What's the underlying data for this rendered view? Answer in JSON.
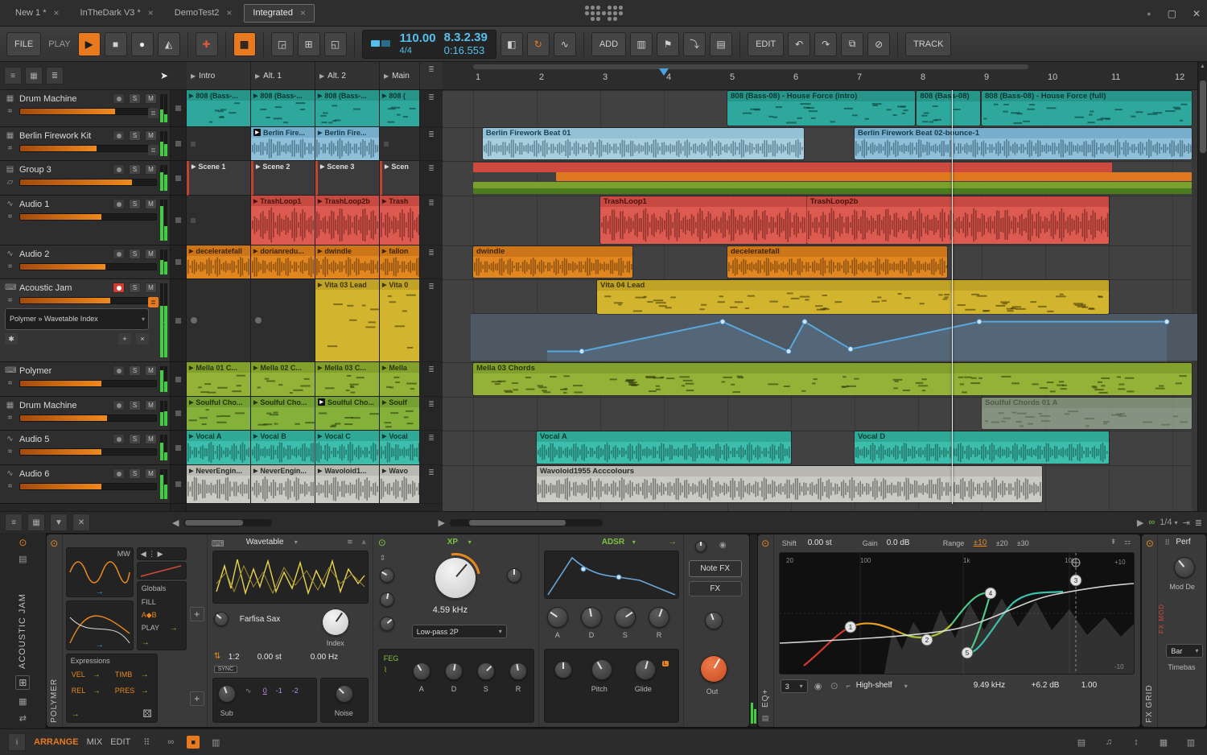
{
  "icons": {
    "close": "×",
    "restore": "▢",
    "conn_dot": "●",
    "play": "▶",
    "stop": "■",
    "record": "●",
    "metronome": "◭",
    "auto_write": "✚",
    "launcher_grid": "▦",
    "clip_rec": "◲",
    "plus": "⊞",
    "capture": "◱",
    "punch_in": "◧",
    "loop": "↻",
    "swing": "∿",
    "bars": "▥",
    "flag": "⚑",
    "arrow_down": "⤵",
    "panel": "▤",
    "undo": "↶",
    "redo": "↷",
    "copy": "⧉",
    "delete": "⊘",
    "pointer": "➤",
    "list": "≡",
    "grid": "▦",
    "menu": "≣",
    "left": "◀",
    "right": "▶",
    "up": "▲",
    "down": "▼",
    "link": "∞",
    "snap": "⇥",
    "info": "i",
    "dice": "⚄",
    "pin": "⊼",
    "star": "✱",
    "keyboard": "⌨",
    "power": "⊙",
    "folder": "▤",
    "swap": "⇄",
    "speaker": "◉",
    "x": "✕",
    "caret": "▾"
  },
  "window": {
    "tabs": [
      {
        "label": "New 1 *",
        "active": false
      },
      {
        "label": "InTheDark V3 *",
        "active": false
      },
      {
        "label": "DemoTest2",
        "active": false
      },
      {
        "label": "Integrated",
        "active": true
      }
    ]
  },
  "toolbar": {
    "file": "FILE",
    "play_label": "PLAY",
    "add": "ADD",
    "edit": "EDIT",
    "track": "TRACK",
    "tempo": "110.00",
    "timesig": "4/4",
    "position": "8.3.2.39",
    "time": "0:16.553"
  },
  "tracks": [
    {
      "name": "Drum Machine",
      "type": "drum",
      "meter": 0.7,
      "menu": "gray"
    },
    {
      "name": "Berlin Firework Kit",
      "type": "drum",
      "meter": 0.56,
      "menu": "gray"
    },
    {
      "name": "Group 3",
      "type": "group",
      "meter": 0.82
    },
    {
      "name": "Audio 1",
      "type": "audio",
      "meter": 0.6
    },
    {
      "name": "Audio 2",
      "type": "audio",
      "meter": 0.63
    },
    {
      "name": "Acoustic Jam",
      "type": "inst",
      "armed": true,
      "meter": 0.66,
      "menu": "orange",
      "device": "Polymer » Wavetable Index"
    },
    {
      "name": "Polymer",
      "type": "inst",
      "meter": 0.6
    },
    {
      "name": "Drum Machine",
      "type": "drum",
      "meter": 0.64
    },
    {
      "name": "Audio 5",
      "type": "audio",
      "meter": 0.6
    },
    {
      "name": "Audio 6",
      "type": "audio",
      "meter": 0.6
    }
  ],
  "scenes": [
    "Intro",
    "Alt. 1",
    "Alt. 2",
    "Main"
  ],
  "clip_grid": [
    {
      "cells": [
        {
          "label": "808 (Bass-...",
          "color": "teal",
          "notes": true
        },
        {
          "label": "808 (Bass-...",
          "color": "teal",
          "notes": true
        },
        {
          "label": "808 (Bass-...",
          "color": "teal",
          "notes": true
        },
        {
          "label": "808 (",
          "color": "teal",
          "notes": true
        }
      ]
    },
    {
      "cells": [
        {
          "empty": true
        },
        {
          "label": "Berlin Fire...",
          "color": "blue",
          "wave": true,
          "playing": true
        },
        {
          "label": "Berlin Fire...",
          "color": "blue",
          "wave": true
        },
        {
          "empty": true
        }
      ]
    },
    {
      "cells": [
        {
          "label": "Scene 1",
          "color": "scene"
        },
        {
          "label": "Scene 2",
          "color": "scene"
        },
        {
          "label": "Scene 3",
          "color": "scene"
        },
        {
          "label": "Scen",
          "color": "scene"
        }
      ]
    },
    {
      "cells": [
        {
          "empty": true
        },
        {
          "label": "TrashLoop1",
          "color": "red",
          "wave": true
        },
        {
          "label": "TrashLoop2b",
          "color": "red",
          "wave": true
        },
        {
          "label": "Trash",
          "color": "red",
          "wave": true
        }
      ]
    },
    {
      "cells": [
        {
          "label": "deceleratefall",
          "color": "orange",
          "wave": true
        },
        {
          "label": "dorianredu...",
          "color": "orange",
          "wave": true
        },
        {
          "label": "dwindle",
          "color": "orange",
          "wave": true
        },
        {
          "label": "fallon",
          "color": "orange",
          "wave": true
        }
      ]
    },
    {
      "cells": [
        {
          "empty": true,
          "dot": true
        },
        {
          "empty": true,
          "dot": true
        },
        {
          "label": "Vita 03 Lead",
          "color": "yellow",
          "notes": true
        },
        {
          "label": "Vita 0",
          "color": "yellow",
          "notes": true
        }
      ]
    },
    {
      "cells": [
        {
          "label": "Mella 01 C...",
          "color": "green",
          "notes": true
        },
        {
          "label": "Mella 02 C...",
          "color": "green",
          "notes": true
        },
        {
          "label": "Mella 03 C...",
          "color": "green",
          "notes": true
        },
        {
          "label": "Mella",
          "color": "green",
          "notes": true
        }
      ]
    },
    {
      "cells": [
        {
          "label": "Soulful Cho...",
          "color": "ltgreen",
          "notes": true
        },
        {
          "label": "Soulful Cho...",
          "color": "ltgreen",
          "notes": true
        },
        {
          "label": "Soulful Cho...",
          "color": "ltgreen",
          "notes": true,
          "playing": true
        },
        {
          "label": "Soulf",
          "color": "ltgreen",
          "notes": true
        }
      ]
    },
    {
      "cells": [
        {
          "label": "Vocal A",
          "color": "vteal",
          "wave": true
        },
        {
          "label": "Vocal B",
          "color": "vteal",
          "wave": true
        },
        {
          "label": "Vocal C",
          "color": "vteal",
          "wave": true
        },
        {
          "label": "Vocal",
          "color": "vteal",
          "wave": true
        }
      ]
    },
    {
      "cells": [
        {
          "label": "NeverEngin...",
          "color": "gray",
          "wave": true
        },
        {
          "label": "NeverEngin...",
          "color": "gray",
          "wave": true
        },
        {
          "label": "Wavoloid1...",
          "color": "gray",
          "wave": true
        },
        {
          "label": "Wavo",
          "color": "gray",
          "wave": true
        }
      ]
    }
  ],
  "ruler": [
    "1",
    "2",
    "3",
    "4",
    "5",
    "6",
    "7",
    "8",
    "9",
    "10",
    "11",
    "12"
  ],
  "playhead_bar": 8.53,
  "marker_bar": 4,
  "arranger_clips": [
    {
      "label": "808 (Bass-08) - House Force (intro)",
      "row": 0,
      "start": 5,
      "end": 7.95,
      "color": "teal",
      "notes": true
    },
    {
      "label": "808 (Bass-08)",
      "row": 0,
      "start": 7.98,
      "end": 8.97,
      "color": "teal",
      "notes": true
    },
    {
      "label": "808 (Bass-08) - House Force (full)",
      "row": 0,
      "start": 9,
      "end": 12.3,
      "color": "teal",
      "notes": true
    },
    {
      "label": "Berlin Firework Beat 01",
      "row": 1,
      "start": 1.15,
      "end": 6.2,
      "color": "ltblue",
      "wave": true
    },
    {
      "label": "Berlin Firework Beat 02-bounce-1",
      "row": 1,
      "start": 7,
      "end": 12.3,
      "color": "blue",
      "wave": true
    },
    {
      "label": "TrashLoop1",
      "row": 3,
      "start": 3,
      "end": 6.25,
      "color": "red",
      "wave": true
    },
    {
      "label": "TrashLoop2b",
      "row": 3,
      "start": 6.25,
      "end": 11,
      "color": "red",
      "wave": true
    },
    {
      "label": "dwindle",
      "row": 4,
      "start": 1,
      "end": 3.5,
      "color": "orange",
      "wave": true
    },
    {
      "label": "deceleratefall",
      "row": 4,
      "start": 5,
      "end": 8.45,
      "color": "orange",
      "wave": true
    },
    {
      "label": "Vita 04 Lead",
      "row": 5,
      "start": 2.95,
      "end": 11,
      "color": "yellow",
      "notes": true,
      "h": 42
    },
    {
      "label": "Mella 03 Chords",
      "row": 6,
      "start": 1,
      "end": 12.3,
      "color": "green",
      "notes": true
    },
    {
      "label": "Soulful Chords 01 A",
      "row": 7,
      "start": 9,
      "end": 12.3,
      "color": "sage",
      "notes": true,
      "faded": true
    },
    {
      "label": "Vocal A",
      "row": 8,
      "start": 2,
      "end": 6,
      "color": "vteal",
      "wave": true
    },
    {
      "label": "Vocal D",
      "row": 8,
      "start": 7,
      "end": 11,
      "color": "vteal",
      "wave": true
    },
    {
      "label": "Wavoloid1955 Acccolours",
      "row": 9,
      "start": 2,
      "end": 9.95,
      "color": "gray",
      "wave": true
    }
  ],
  "group_strips": [
    {
      "start": 1,
      "end": 11.05,
      "color": "#cf4a3e",
      "y": 0,
      "h": 0.3
    },
    {
      "start": 2.3,
      "end": 12.3,
      "color": "#e07820",
      "y": 0.32,
      "h": 0.28
    },
    {
      "start": 1,
      "end": 12.3,
      "color": "#7aa12e",
      "y": 0.62,
      "h": 0.19
    },
    {
      "start": 1,
      "end": 12.3,
      "color": "#4c7a1e",
      "y": 0.81,
      "h": 0.19
    }
  ],
  "automation": {
    "points": [
      [
        130,
        0.88
      ],
      [
        173,
        0.88
      ],
      [
        348,
        0.08
      ],
      [
        430,
        0.88
      ],
      [
        450,
        0.08
      ],
      [
        507,
        0.82
      ],
      [
        667,
        0.08
      ],
      [
        900,
        0.08
      ]
    ]
  },
  "scroll": {
    "zoom": "1/4"
  },
  "device_panel": {
    "track_label": "ACOUSTIC JAM",
    "polymer": {
      "label": "POLYMER",
      "mw": "MW",
      "globals": "Globals",
      "fill": "FILL",
      "ab": "A◆B",
      "play": "PLAY",
      "expressions": "Expressions",
      "vel": "VEL",
      "timb": "TIMB",
      "rel": "REL",
      "pres": "PRES",
      "wavetable_title": "Wavetable",
      "preset": "Farfisa Sax",
      "index": "Index",
      "ratio": "1:2",
      "semi": "0.00 st",
      "hz": "0.00 Hz",
      "sync": "SYNC",
      "sub": "Sub",
      "sub_0": "0",
      "sub_m1": "-1",
      "sub_m2": "-2",
      "noise": "Noise"
    },
    "filter": {
      "title": "XP",
      "cutoff": "4.59 kHz",
      "mode": "Low-pass 2P",
      "feg": "FEG",
      "a": "A",
      "d": "D",
      "s": "S",
      "r": "R"
    },
    "env": {
      "title": "ADSR",
      "a": "A",
      "d": "D",
      "s": "S",
      "r": "R",
      "pitch": "Pitch",
      "glide": "Glide",
      "glide_l": "L"
    },
    "notefx": "Note FX",
    "fx": "FX",
    "out": "Out",
    "eq": {
      "label": "EQ+",
      "shift_label": "Shift",
      "shift": "0.00 st",
      "gain_label": "Gain",
      "gain": "0.0 dB",
      "range_label": "Range",
      "r1": "±10",
      "r2": "±20",
      "r3": "±30",
      "f20": "20",
      "f100": "100",
      "f1k": "1k",
      "f10k": "10k",
      "dbp": "+10",
      "dbm": "-10",
      "band": "3",
      "band_type": "High-shelf",
      "freq": "9.49 kHz",
      "band_gain": "+6.2 dB",
      "q": "1.00",
      "n1": "1",
      "n2": "2",
      "n3": "3",
      "n4": "4",
      "n5": "5"
    },
    "fxgrid": {
      "label": "FX GRID",
      "fxmod": "FX MOD",
      "perf": "Perf",
      "mod": "Mod De",
      "bar": "Bar",
      "timebase": "Timebas"
    }
  },
  "footer": {
    "arrange": "ARRANGE",
    "mix": "MIX",
    "edit": "EDIT"
  }
}
